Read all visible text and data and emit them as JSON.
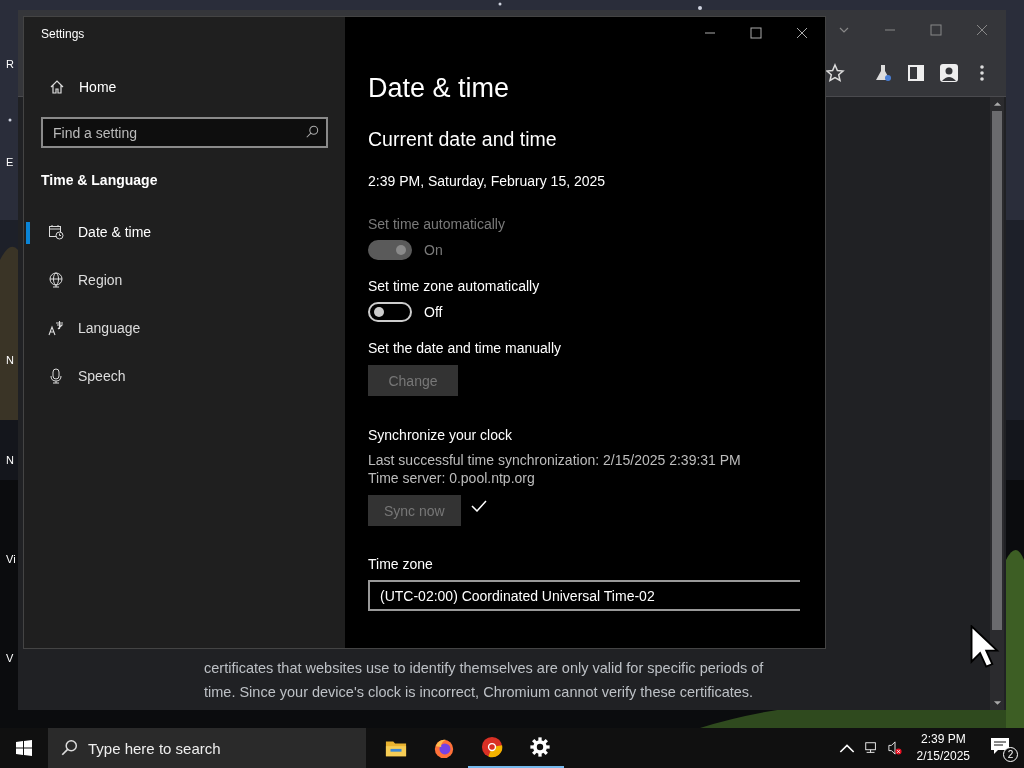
{
  "desktop": {
    "icon_labels": [
      "R",
      "E",
      "N",
      "N",
      "Vi",
      "V"
    ]
  },
  "browser": {
    "message_lines": [
      "certificates that websites use to identify themselves are only valid for specific periods of",
      "time. Since your device's clock is incorrect, Chromium cannot verify these certificates."
    ]
  },
  "settings": {
    "window": {
      "title": "Settings"
    },
    "sidebar": {
      "home": "Home",
      "search": {
        "placeholder": "Find a setting"
      },
      "section": "Time & Language",
      "items": [
        {
          "label": "Date & time",
          "kind": "clock",
          "selected": true
        },
        {
          "label": "Region",
          "kind": "globe",
          "selected": false
        },
        {
          "label": "Language",
          "kind": "language",
          "selected": false
        },
        {
          "label": "Speech",
          "kind": "microphone",
          "selected": false
        }
      ]
    },
    "page": {
      "title": "Date & time",
      "heading": "Current date and time",
      "current": "2:39 PM, Saturday, February 15, 2025",
      "toggles": [
        {
          "label": "Set time automatically",
          "state_text": "On",
          "on": true,
          "disabled": true
        },
        {
          "label": "Set time zone automatically",
          "state_text": "Off",
          "on": false,
          "disabled": false
        }
      ],
      "manual": {
        "label": "Set the date and time manually",
        "button": {
          "label": "Change",
          "disabled": true
        }
      },
      "sync": {
        "heading": "Synchronize your clock",
        "last": "Last successful time synchronization: 2/15/2025 2:39:31 PM",
        "server": "Time server: 0.pool.ntp.org",
        "button": {
          "label": "Sync now",
          "disabled": true
        },
        "succeeded": true
      },
      "time_zone": {
        "label": "Time zone",
        "value": "(UTC-02:00) Coordinated Universal Time-02"
      }
    }
  },
  "taskbar": {
    "search": {
      "placeholder": "Type here to search"
    },
    "apps": [
      {
        "kind": "folder",
        "running": false
      },
      {
        "kind": "firefox",
        "running": false
      },
      {
        "kind": "chromium",
        "running": true
      },
      {
        "kind": "settings",
        "running": true
      }
    ],
    "time": "2:39 PM",
    "date": "2/15/2025",
    "notification_count": "2"
  }
}
